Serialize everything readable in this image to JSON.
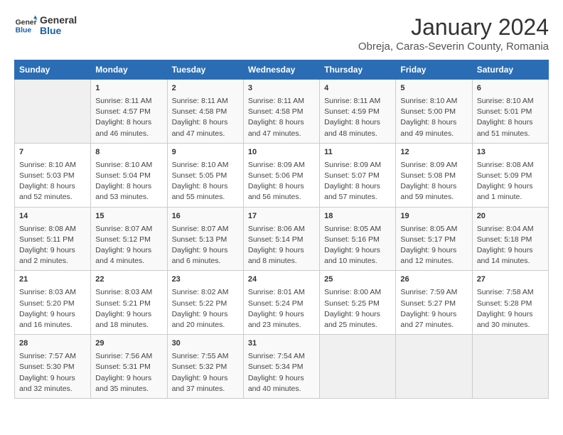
{
  "header": {
    "logo_general": "General",
    "logo_blue": "Blue",
    "title": "January 2024",
    "subtitle": "Obreja, Caras-Severin County, Romania"
  },
  "days_of_week": [
    "Sunday",
    "Monday",
    "Tuesday",
    "Wednesday",
    "Thursday",
    "Friday",
    "Saturday"
  ],
  "weeks": [
    [
      {
        "day": "",
        "content": ""
      },
      {
        "day": "1",
        "content": "Sunrise: 8:11 AM\nSunset: 4:57 PM\nDaylight: 8 hours\nand 46 minutes."
      },
      {
        "day": "2",
        "content": "Sunrise: 8:11 AM\nSunset: 4:58 PM\nDaylight: 8 hours\nand 47 minutes."
      },
      {
        "day": "3",
        "content": "Sunrise: 8:11 AM\nSunset: 4:58 PM\nDaylight: 8 hours\nand 47 minutes."
      },
      {
        "day": "4",
        "content": "Sunrise: 8:11 AM\nSunset: 4:59 PM\nDaylight: 8 hours\nand 48 minutes."
      },
      {
        "day": "5",
        "content": "Sunrise: 8:10 AM\nSunset: 5:00 PM\nDaylight: 8 hours\nand 49 minutes."
      },
      {
        "day": "6",
        "content": "Sunrise: 8:10 AM\nSunset: 5:01 PM\nDaylight: 8 hours\nand 51 minutes."
      }
    ],
    [
      {
        "day": "7",
        "content": "Sunrise: 8:10 AM\nSunset: 5:03 PM\nDaylight: 8 hours\nand 52 minutes."
      },
      {
        "day": "8",
        "content": "Sunrise: 8:10 AM\nSunset: 5:04 PM\nDaylight: 8 hours\nand 53 minutes."
      },
      {
        "day": "9",
        "content": "Sunrise: 8:10 AM\nSunset: 5:05 PM\nDaylight: 8 hours\nand 55 minutes."
      },
      {
        "day": "10",
        "content": "Sunrise: 8:09 AM\nSunset: 5:06 PM\nDaylight: 8 hours\nand 56 minutes."
      },
      {
        "day": "11",
        "content": "Sunrise: 8:09 AM\nSunset: 5:07 PM\nDaylight: 8 hours\nand 57 minutes."
      },
      {
        "day": "12",
        "content": "Sunrise: 8:09 AM\nSunset: 5:08 PM\nDaylight: 8 hours\nand 59 minutes."
      },
      {
        "day": "13",
        "content": "Sunrise: 8:08 AM\nSunset: 5:09 PM\nDaylight: 9 hours\nand 1 minute."
      }
    ],
    [
      {
        "day": "14",
        "content": "Sunrise: 8:08 AM\nSunset: 5:11 PM\nDaylight: 9 hours\nand 2 minutes."
      },
      {
        "day": "15",
        "content": "Sunrise: 8:07 AM\nSunset: 5:12 PM\nDaylight: 9 hours\nand 4 minutes."
      },
      {
        "day": "16",
        "content": "Sunrise: 8:07 AM\nSunset: 5:13 PM\nDaylight: 9 hours\nand 6 minutes."
      },
      {
        "day": "17",
        "content": "Sunrise: 8:06 AM\nSunset: 5:14 PM\nDaylight: 9 hours\nand 8 minutes."
      },
      {
        "day": "18",
        "content": "Sunrise: 8:05 AM\nSunset: 5:16 PM\nDaylight: 9 hours\nand 10 minutes."
      },
      {
        "day": "19",
        "content": "Sunrise: 8:05 AM\nSunset: 5:17 PM\nDaylight: 9 hours\nand 12 minutes."
      },
      {
        "day": "20",
        "content": "Sunrise: 8:04 AM\nSunset: 5:18 PM\nDaylight: 9 hours\nand 14 minutes."
      }
    ],
    [
      {
        "day": "21",
        "content": "Sunrise: 8:03 AM\nSunset: 5:20 PM\nDaylight: 9 hours\nand 16 minutes."
      },
      {
        "day": "22",
        "content": "Sunrise: 8:03 AM\nSunset: 5:21 PM\nDaylight: 9 hours\nand 18 minutes."
      },
      {
        "day": "23",
        "content": "Sunrise: 8:02 AM\nSunset: 5:22 PM\nDaylight: 9 hours\nand 20 minutes."
      },
      {
        "day": "24",
        "content": "Sunrise: 8:01 AM\nSunset: 5:24 PM\nDaylight: 9 hours\nand 23 minutes."
      },
      {
        "day": "25",
        "content": "Sunrise: 8:00 AM\nSunset: 5:25 PM\nDaylight: 9 hours\nand 25 minutes."
      },
      {
        "day": "26",
        "content": "Sunrise: 7:59 AM\nSunset: 5:27 PM\nDaylight: 9 hours\nand 27 minutes."
      },
      {
        "day": "27",
        "content": "Sunrise: 7:58 AM\nSunset: 5:28 PM\nDaylight: 9 hours\nand 30 minutes."
      }
    ],
    [
      {
        "day": "28",
        "content": "Sunrise: 7:57 AM\nSunset: 5:30 PM\nDaylight: 9 hours\nand 32 minutes."
      },
      {
        "day": "29",
        "content": "Sunrise: 7:56 AM\nSunset: 5:31 PM\nDaylight: 9 hours\nand 35 minutes."
      },
      {
        "day": "30",
        "content": "Sunrise: 7:55 AM\nSunset: 5:32 PM\nDaylight: 9 hours\nand 37 minutes."
      },
      {
        "day": "31",
        "content": "Sunrise: 7:54 AM\nSunset: 5:34 PM\nDaylight: 9 hours\nand 40 minutes."
      },
      {
        "day": "",
        "content": ""
      },
      {
        "day": "",
        "content": ""
      },
      {
        "day": "",
        "content": ""
      }
    ]
  ]
}
